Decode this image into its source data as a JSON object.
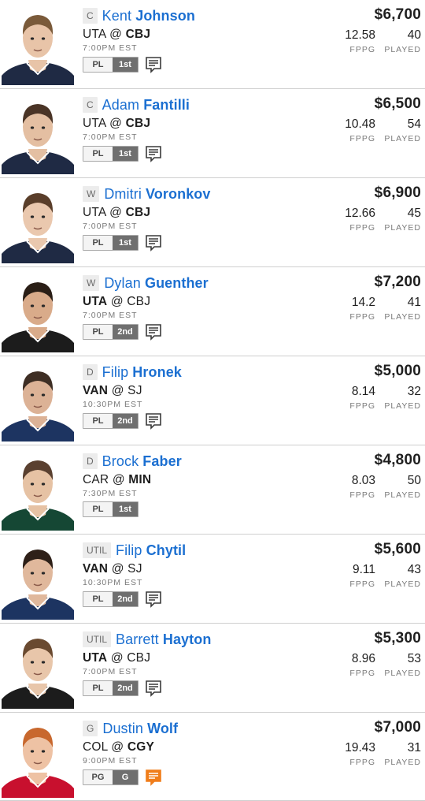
{
  "players": [
    {
      "pos": "C",
      "first": "Kent",
      "last": "Johnson",
      "home": "UTA",
      "away": "CBJ",
      "bold": "away",
      "time": "7:00PM EST",
      "salary": "$6,700",
      "fppg": "12.58",
      "played": "40",
      "tag_a": "PL",
      "tag_b": "1st",
      "note": "gray",
      "jersey": "#1f2a44",
      "skin": "#e8c4a8",
      "hair": "#7a5a3a"
    },
    {
      "pos": "C",
      "first": "Adam",
      "last": "Fantilli",
      "home": "UTA",
      "away": "CBJ",
      "bold": "away",
      "time": "7:00PM EST",
      "salary": "$6,500",
      "fppg": "10.48",
      "played": "54",
      "tag_a": "PL",
      "tag_b": "1st",
      "note": "gray",
      "jersey": "#1f2a44",
      "skin": "#e4bfa2",
      "hair": "#4a3426"
    },
    {
      "pos": "W",
      "first": "Dmitri",
      "last": "Voronkov",
      "home": "UTA",
      "away": "CBJ",
      "bold": "away",
      "time": "7:00PM EST",
      "salary": "$6,900",
      "fppg": "12.66",
      "played": "45",
      "tag_a": "PL",
      "tag_b": "1st",
      "note": "gray",
      "jersey": "#1f2a44",
      "skin": "#eac8ae",
      "hair": "#5a3e2a"
    },
    {
      "pos": "W",
      "first": "Dylan",
      "last": "Guenther",
      "home": "UTA",
      "away": "CBJ",
      "bold": "home",
      "time": "7:00PM EST",
      "salary": "$7,200",
      "fppg": "14.2",
      "played": "41",
      "tag_a": "PL",
      "tag_b": "2nd",
      "note": "gray",
      "jersey": "#1c1c1c",
      "skin": "#d9ab8a",
      "hair": "#2a1e16"
    },
    {
      "pos": "D",
      "first": "Filip",
      "last": "Hronek",
      "home": "VAN",
      "away": "SJ",
      "bold": "home",
      "time": "10:30PM EST",
      "salary": "$5,000",
      "fppg": "8.14",
      "played": "32",
      "tag_a": "PL",
      "tag_b": "2nd",
      "note": "gray",
      "jersey": "#1d3461",
      "skin": "#dcb296",
      "hair": "#3e2e24"
    },
    {
      "pos": "D",
      "first": "Brock",
      "last": "Faber",
      "home": "CAR",
      "away": "MIN",
      "bold": "away",
      "time": "7:30PM EST",
      "salary": "$4,800",
      "fppg": "8.03",
      "played": "50",
      "tag_a": "PL",
      "tag_b": "1st",
      "note": "none",
      "jersey": "#154734",
      "skin": "#e6c2a4",
      "hair": "#5a4030"
    },
    {
      "pos": "UTIL",
      "first": "Filip",
      "last": "Chytil",
      "home": "VAN",
      "away": "SJ",
      "bold": "home",
      "time": "10:30PM EST",
      "salary": "$5,600",
      "fppg": "9.11",
      "played": "43",
      "tag_a": "PL",
      "tag_b": "2nd",
      "note": "gray",
      "jersey": "#1d3461",
      "skin": "#e0b89c",
      "hair": "#2e2018"
    },
    {
      "pos": "UTIL",
      "first": "Barrett",
      "last": "Hayton",
      "home": "UTA",
      "away": "CBJ",
      "bold": "home",
      "time": "7:00PM EST",
      "salary": "$5,300",
      "fppg": "8.96",
      "played": "53",
      "tag_a": "PL",
      "tag_b": "2nd",
      "note": "gray",
      "jersey": "#1c1c1c",
      "skin": "#e8c6aa",
      "hair": "#6a4a30"
    },
    {
      "pos": "G",
      "first": "Dustin",
      "last": "Wolf",
      "home": "COL",
      "away": "CGY",
      "bold": "away",
      "time": "9:00PM EST",
      "salary": "$7,000",
      "fppg": "19.43",
      "played": "31",
      "tag_a": "PG",
      "tag_b": "G",
      "note": "orange",
      "jersey": "#c8102e",
      "skin": "#eec2a4",
      "hair": "#c8682e"
    }
  ],
  "labels": {
    "at": "@",
    "fppg": "FPPG",
    "played": "PLAYED"
  },
  "colors": {
    "link": "#1b6fd1",
    "note_gray": "#3a3a3a",
    "note_orange": "#f07d1a"
  }
}
